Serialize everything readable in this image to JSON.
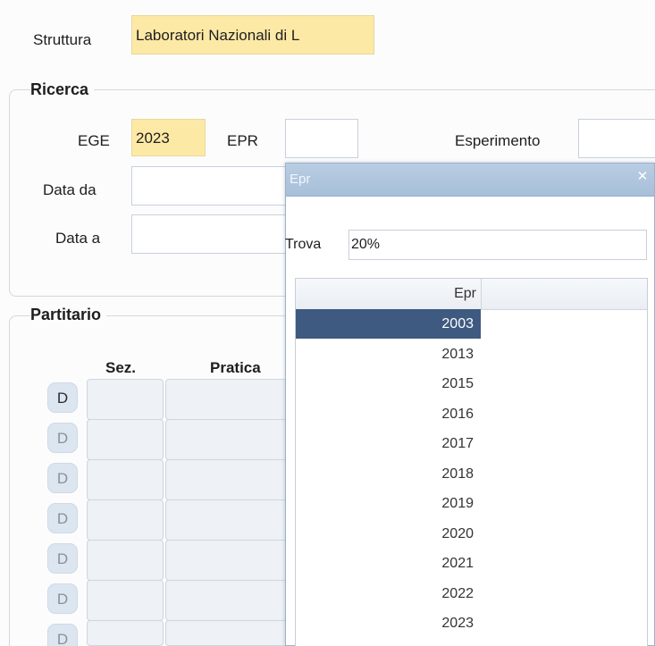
{
  "struttura": {
    "label": "Struttura",
    "value": "Laboratori Nazionali di L"
  },
  "ricerca": {
    "title": "Ricerca",
    "ege_label": "EGE",
    "ege_value": "2023",
    "epr_label": "EPR",
    "epr_value": "",
    "esperimento_label": "Esperimento",
    "esperimento_value": "",
    "data_da_label": "Data da",
    "data_da_value": "",
    "data_a_label": "Data a",
    "data_a_value": ""
  },
  "partitario": {
    "title": "Partitario",
    "columns": [
      "Sez.",
      "Pratica"
    ],
    "row_button_label": "D",
    "rows": 7
  },
  "popup": {
    "title": "Epr",
    "close_icon": "close-icon",
    "trova_label": "Trova",
    "trova_value": "20%",
    "list_header": "Epr",
    "items": [
      "2003",
      "2013",
      "2015",
      "2016",
      "2017",
      "2018",
      "2019",
      "2020",
      "2021",
      "2022",
      "2023"
    ],
    "selected_index": 0
  },
  "colors": {
    "yellow_field": "#fde9a6",
    "selected_row": "#3e5a80",
    "titlebar": "#a7bfd9",
    "row_button": "#dce6f1"
  }
}
